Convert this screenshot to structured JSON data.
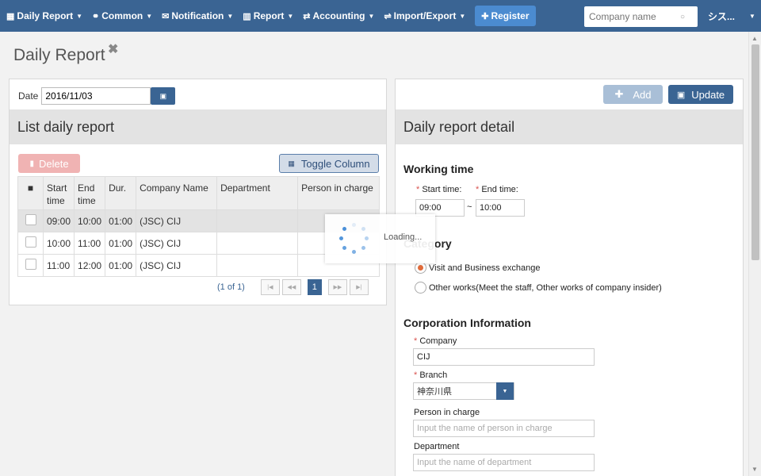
{
  "nav": {
    "items": [
      {
        "icon": "calendar-icon",
        "glyph": "▦",
        "label": "Daily Report"
      },
      {
        "icon": "common-icon",
        "glyph": "⚭",
        "label": "Common"
      },
      {
        "icon": "envelope-icon",
        "glyph": "✉",
        "label": "Notification"
      },
      {
        "icon": "bar-chart-icon",
        "glyph": "▥",
        "label": "Report"
      },
      {
        "icon": "exchange-icon",
        "glyph": "⇄",
        "label": "Accounting"
      },
      {
        "icon": "import-export-icon",
        "glyph": "⇌",
        "label": "Import/Export"
      }
    ],
    "register_label": "Register",
    "search_placeholder": "Company name",
    "user_label": "シス..."
  },
  "page": {
    "title": "Daily Report"
  },
  "left": {
    "date_label": "Date",
    "date_value": "2016/11/03",
    "section_title": "List daily report",
    "delete_label": "Delete",
    "toggle_label": "Toggle Column",
    "columns": [
      "Start time",
      "End time",
      "Dur.",
      "Company Name",
      "Department",
      "Person in charge"
    ],
    "rows": [
      {
        "start": "09:00",
        "end": "10:00",
        "dur": "01:00",
        "company": "(JSC) CIJ",
        "department": "",
        "person": ""
      },
      {
        "start": "10:00",
        "end": "11:00",
        "dur": "01:00",
        "company": "(JSC) CIJ",
        "department": "",
        "person": ""
      },
      {
        "start": "11:00",
        "end": "12:00",
        "dur": "01:00",
        "company": "(JSC) CIJ",
        "department": "",
        "person": ""
      }
    ],
    "pager_info": "(1 of 1)",
    "current_page": "1"
  },
  "right": {
    "add_label": "Add",
    "update_label": "Update",
    "section_title": "Daily report detail",
    "working_time_title": "Working time",
    "start_label": "Start time:",
    "end_label": "End time:",
    "start_value": "09:00",
    "end_value": "10:00",
    "tilde": "~",
    "category_title": "Category",
    "category_options": [
      "Visit and Business exchange",
      "Other works(Meet the staff, Other works of company insider)"
    ],
    "corp_title": "Corporation Information",
    "company_label": "Company",
    "company_value": "CIJ",
    "branch_label": "Branch",
    "branch_value": "神奈川県",
    "person_label": "Person in charge",
    "person_placeholder": "Input the name of person in charge",
    "dept_label": "Department",
    "dept_placeholder": "Input the name of department"
  },
  "loading": {
    "text": "Loading..."
  },
  "colors": {
    "nav_bg": "#3a6493",
    "primary": "#3a6493",
    "danger_light": "#f0b3b3",
    "required": "#d9534f",
    "spinner": "#4a90d9"
  }
}
